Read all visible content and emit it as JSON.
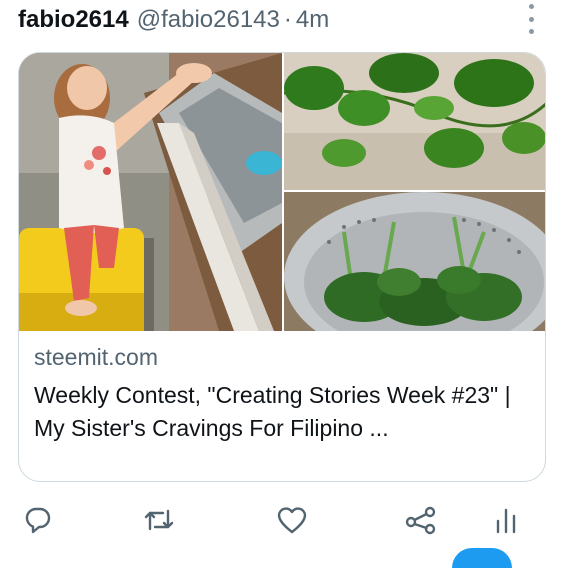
{
  "tweet": {
    "display_name": "fabio2614",
    "handle": "@fabio26143",
    "separator": "·",
    "time": "4m"
  },
  "card": {
    "domain": "steemit.com",
    "title": "Weekly Contest, \"Creating Stories Week #23\" | My Sister's Cravings For Filipino ..."
  },
  "actions": {
    "reply_icon": "reply-icon",
    "retweet_icon": "retweet-icon",
    "like_icon": "heart-icon",
    "share_icon": "share-icon",
    "analytics_icon": "analytics-icon"
  },
  "colors": {
    "text": "#0f1419",
    "secondary": "#536471",
    "border": "#cfd9de",
    "accent": "#1d9bf0"
  }
}
